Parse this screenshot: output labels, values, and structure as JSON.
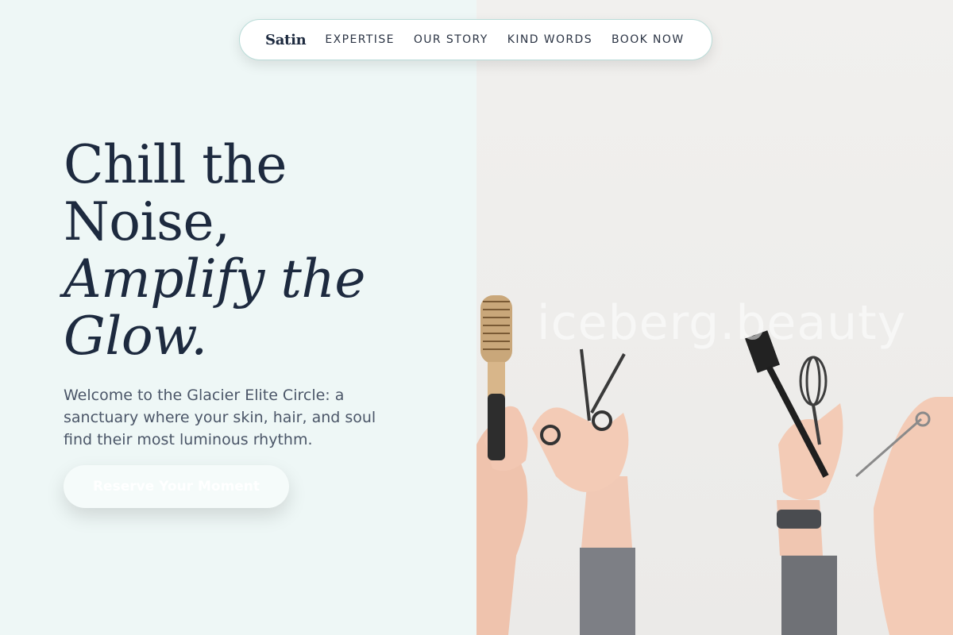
{
  "nav": {
    "brand": "Satin",
    "links": [
      "EXPERTISE",
      "OUR STORY",
      "KIND WORDS",
      "BOOK NOW"
    ]
  },
  "hero": {
    "title_lines": [
      "Chill the",
      "Noise,",
      "Amplify the",
      "Glow."
    ],
    "description": "Welcome to the Glacier Elite Circle: a sanctuary where your skin, hair, and soul find their most luminous rhythm.",
    "cta_label": "Reserve Your Moment"
  },
  "image": {
    "watermark": "iceberg.beauty",
    "content": "Raised hands holding salon tools: round brush, scissors, tint brush, whisk"
  },
  "colors": {
    "left_background": "#eef7f6",
    "heading": "#1d2a3f",
    "body_text": "#4b5668",
    "nav_border": "#b9dcd8"
  }
}
